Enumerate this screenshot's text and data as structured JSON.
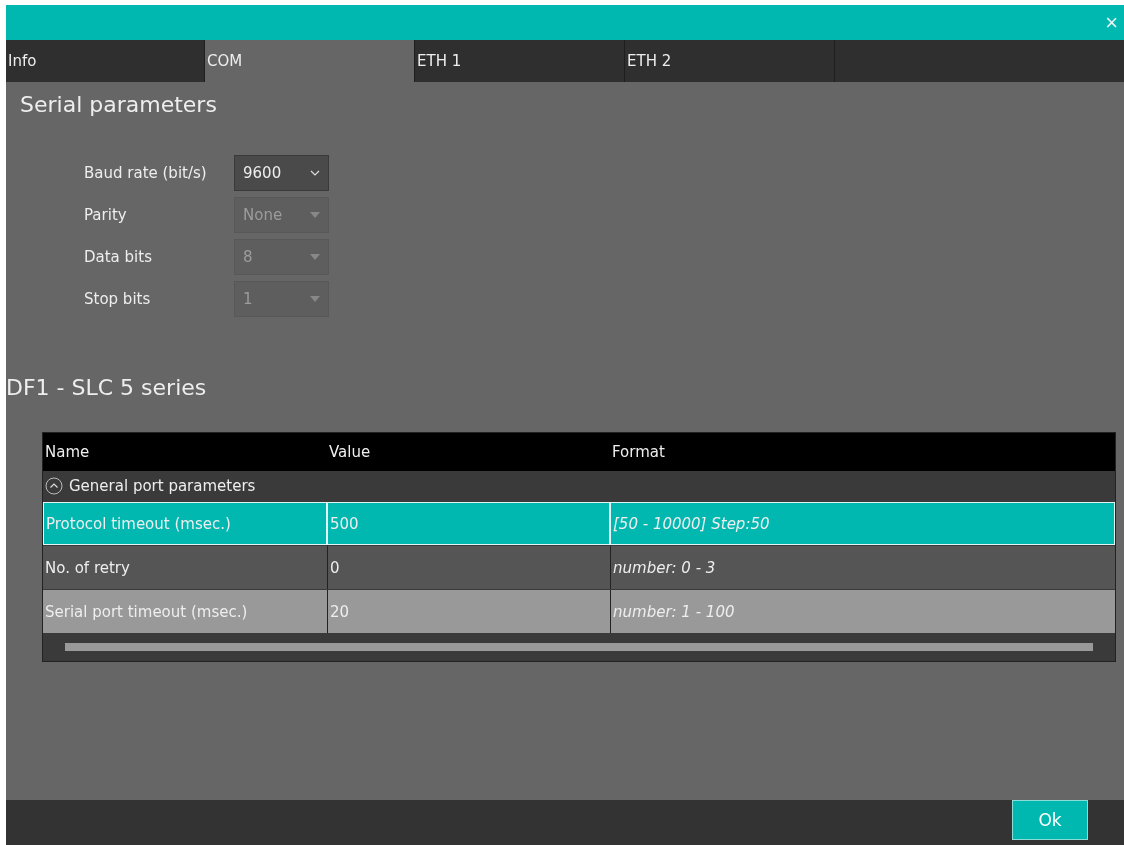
{
  "window": {
    "close": "×"
  },
  "tabs": [
    {
      "label": "Info",
      "selected": false
    },
    {
      "label": "COM",
      "selected": true
    },
    {
      "label": "ETH 1",
      "selected": false
    },
    {
      "label": "ETH 2",
      "selected": false
    }
  ],
  "serial": {
    "title": "Serial parameters",
    "fields": [
      {
        "label": "Baud rate (bit/s)",
        "value": "9600",
        "disabled": false
      },
      {
        "label": "Parity",
        "value": "None",
        "disabled": true
      },
      {
        "label": "Data bits",
        "value": "8",
        "disabled": true
      },
      {
        "label": "Stop bits",
        "value": "1",
        "disabled": true
      }
    ]
  },
  "protocol": {
    "title": "DF1 - SLC 5 series",
    "table": {
      "columns": [
        "Name",
        "Value",
        "Format"
      ],
      "group": {
        "label": "General port parameters",
        "expanded": true
      },
      "rows": [
        {
          "name": "Protocol timeout (msec.)",
          "value": "500",
          "format": "[50 - 10000] Step:50",
          "selected": true
        },
        {
          "name": "No. of retry",
          "value": "0",
          "format": "number: 0 - 3",
          "selected": false
        },
        {
          "name": "Serial port timeout (msec.)",
          "value": "20",
          "format": "number: 1 - 100",
          "selected": false
        }
      ]
    }
  },
  "buttons": [
    "Ok"
  ]
}
